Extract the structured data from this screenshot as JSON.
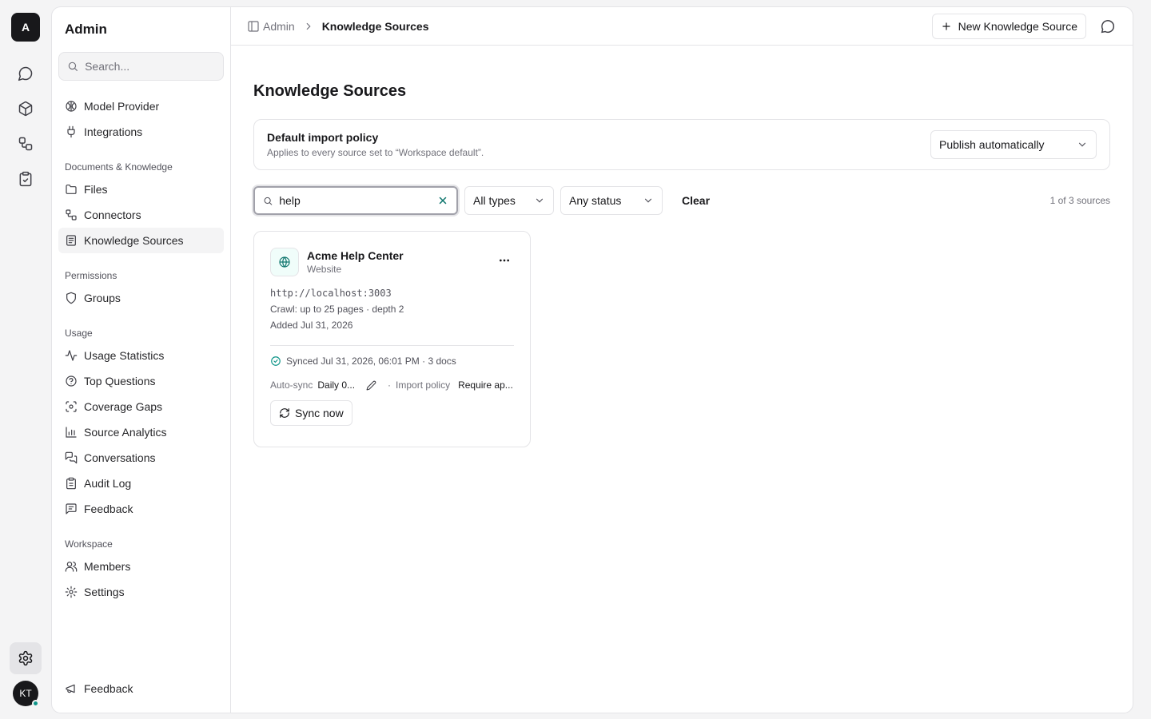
{
  "rail": {
    "logo": "A",
    "user_initials": "KT",
    "items": [
      {
        "icon": "chat-bubble-icon"
      },
      {
        "icon": "cube-icon"
      },
      {
        "icon": "workflow-icon"
      },
      {
        "icon": "clipboard-check-icon"
      }
    ]
  },
  "sidebar": {
    "title": "Admin",
    "search_placeholder": "Search...",
    "top_items": [
      {
        "label": "Model Provider",
        "icon": "brain-icon"
      },
      {
        "label": "Integrations",
        "icon": "plug-icon"
      }
    ],
    "groups": [
      {
        "label": "Documents & Knowledge",
        "items": [
          {
            "label": "Files",
            "icon": "folder-icon"
          },
          {
            "label": "Connectors",
            "icon": "connectors-icon"
          },
          {
            "label": "Knowledge Sources",
            "icon": "book-icon",
            "active": true
          }
        ]
      },
      {
        "label": "Permissions",
        "items": [
          {
            "label": "Groups",
            "icon": "shield-icon"
          }
        ]
      },
      {
        "label": "Usage",
        "items": [
          {
            "label": "Usage Statistics",
            "icon": "activity-icon"
          },
          {
            "label": "Top Questions",
            "icon": "help-circle-icon"
          },
          {
            "label": "Coverage Gaps",
            "icon": "scan-icon"
          },
          {
            "label": "Source Analytics",
            "icon": "bar-chart-icon"
          },
          {
            "label": "Conversations",
            "icon": "messages-icon"
          },
          {
            "label": "Audit Log",
            "icon": "clipboard-list-icon"
          },
          {
            "label": "Feedback",
            "icon": "message-square-text-icon"
          }
        ]
      },
      {
        "label": "Workspace",
        "items": [
          {
            "label": "Members",
            "icon": "users-icon"
          },
          {
            "label": "Settings",
            "icon": "gear-icon"
          }
        ]
      }
    ],
    "footer_label": "Feedback"
  },
  "topbar": {
    "breadcrumb_root": "Admin",
    "breadcrumb_current": "Knowledge Sources",
    "new_button": "New Knowledge Source"
  },
  "page": {
    "title": "Knowledge Sources",
    "policy": {
      "title": "Default import policy",
      "subtitle": "Applies to every source set to “Workspace default”.",
      "selected": "Publish automatically"
    },
    "filters": {
      "search_value": "help",
      "type": "All types",
      "status": "Any status",
      "clear": "Clear",
      "count": "1 of 3 sources"
    },
    "cards": [
      {
        "name": "Acme Help Center",
        "type": "Website",
        "url": "http://localhost:3003",
        "crawl": "Crawl: up to 25 pages · depth 2",
        "added": "Added Jul 31, 2026",
        "synced": "Synced Jul 31, 2026, 06:01 PM · 3 docs",
        "autosync_label": "Auto-sync",
        "autosync_value": "Daily 0...",
        "separator": "·",
        "import_policy_label": "Import policy",
        "import_policy_value": "Require ap...",
        "sync_button": "Sync now"
      }
    ]
  },
  "colors": {
    "accent": "#0f766e",
    "status_ok": "#0d9488",
    "border": "#e4e4e7"
  }
}
